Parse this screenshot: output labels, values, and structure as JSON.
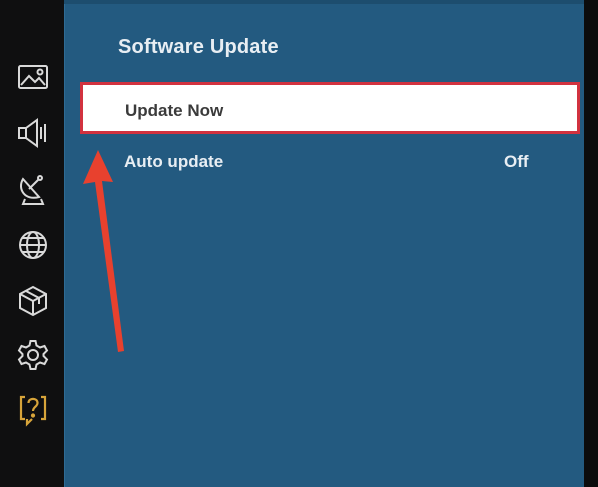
{
  "menu": {
    "title": "Software Update",
    "items": [
      {
        "label": "Update Now"
      },
      {
        "label": "Auto update",
        "value": "Off"
      }
    ]
  },
  "sidebar": {
    "icons": [
      "picture-icon",
      "sound-icon",
      "satellite-icon",
      "network-globe-icon",
      "apps-box-icon",
      "settings-gear-icon",
      "help-icon"
    ]
  },
  "colors": {
    "panel": "#235a80",
    "highlight_border": "#d2323f",
    "annotation_arrow": "#e8412e",
    "help_icon": "#d7a43a"
  }
}
